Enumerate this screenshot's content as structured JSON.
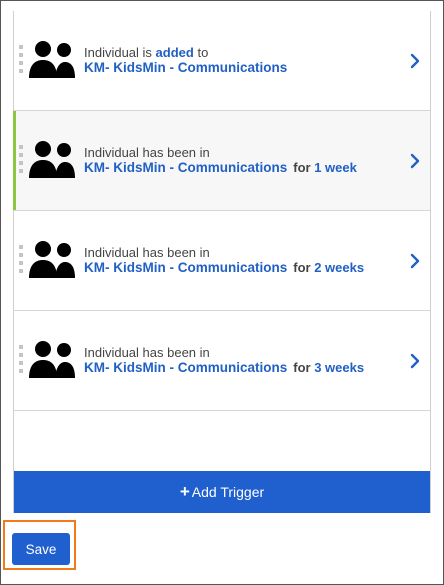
{
  "triggers": [
    {
      "prefix": "Individual is ",
      "action": "added",
      "suffix": " to",
      "group": "KM- KidsMin - Communications",
      "duration_prefix": "",
      "duration_value": ""
    },
    {
      "prefix": "Individual has been in",
      "action": "",
      "suffix": "",
      "group": "KM- KidsMin - Communications",
      "duration_prefix": "for ",
      "duration_value": "1 week"
    },
    {
      "prefix": "Individual has been in",
      "action": "",
      "suffix": "",
      "group": "KM- KidsMin - Communications",
      "duration_prefix": "for ",
      "duration_value": "2 weeks"
    },
    {
      "prefix": "Individual has been in",
      "action": "",
      "suffix": "",
      "group": "KM- KidsMin - Communications",
      "duration_prefix": "for ",
      "duration_value": "3 weeks"
    }
  ],
  "add_trigger_icon": "+",
  "add_trigger_label": "Add Trigger",
  "save_label": "Save",
  "icons": {
    "person": "people-icon",
    "chevron": "chevron-right-icon",
    "grip": "drag-handle-icon"
  },
  "colors": {
    "accent": "#2160c4",
    "button": "#1f5fce",
    "selected_bar": "#8dc63f",
    "highlight_outline": "#f27a1a"
  }
}
